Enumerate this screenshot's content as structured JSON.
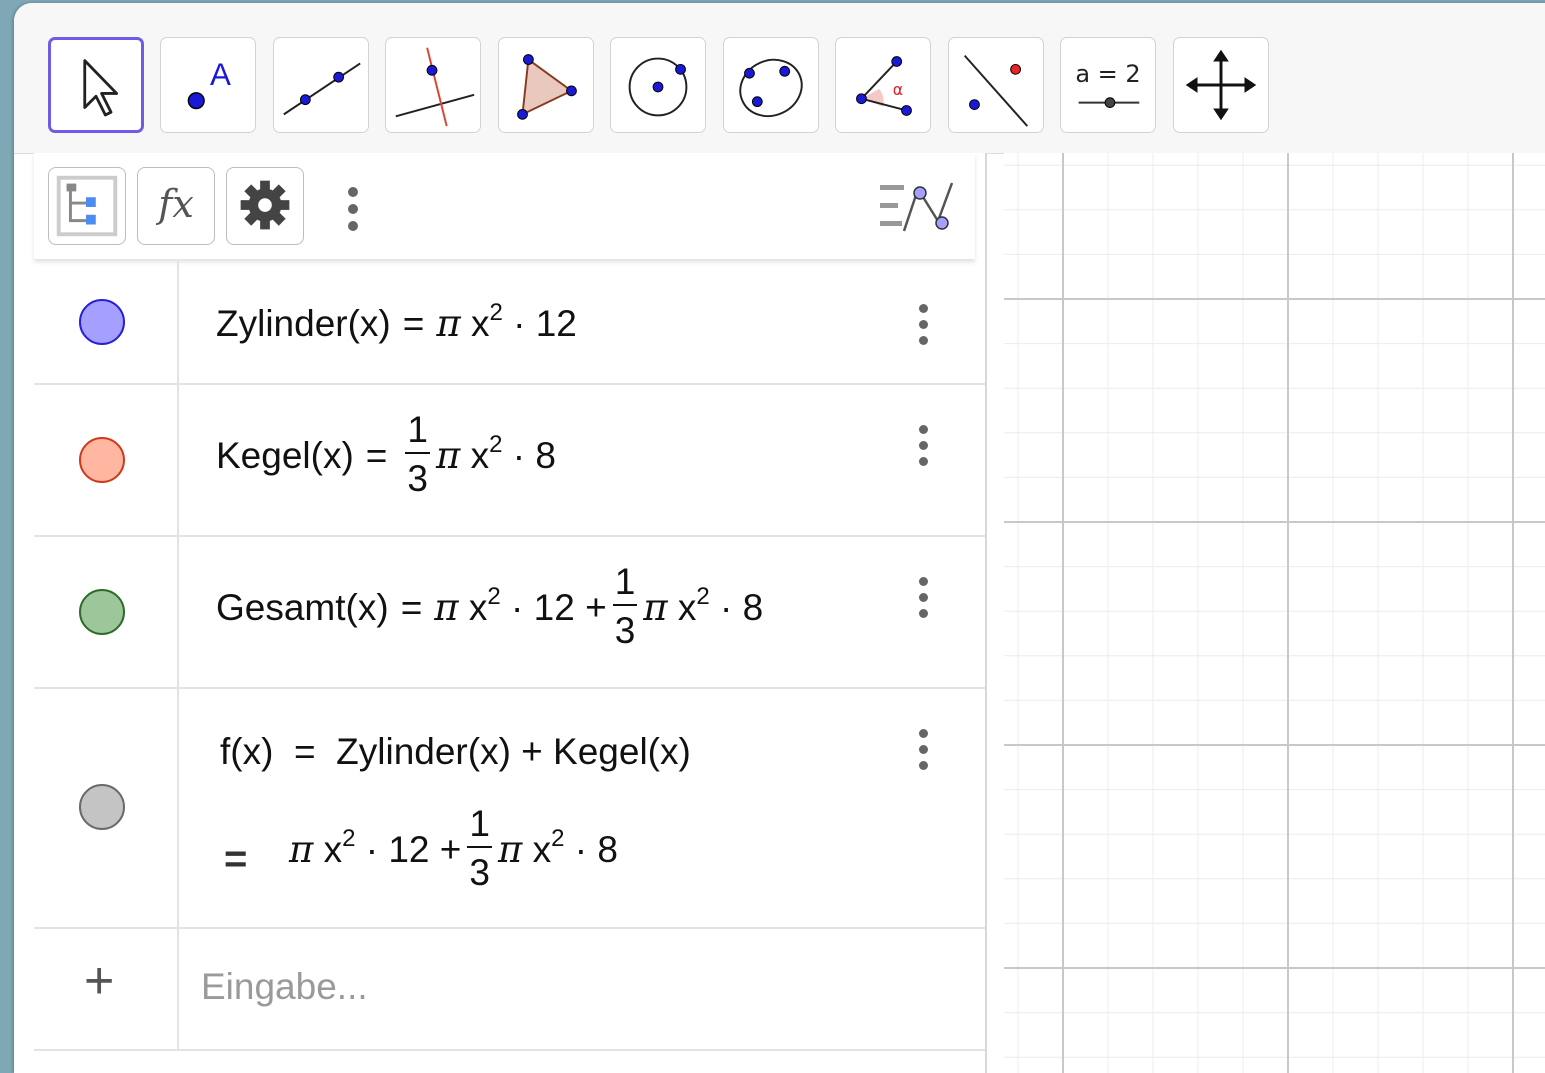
{
  "toolbar": {
    "tools": [
      {
        "name": "move-tool",
        "selected": true
      },
      {
        "name": "point-tool",
        "glyph": "A"
      },
      {
        "name": "line-tool"
      },
      {
        "name": "perpendicular-line-tool"
      },
      {
        "name": "polygon-tool"
      },
      {
        "name": "circle-center-point-tool"
      },
      {
        "name": "conic-five-points-tool"
      },
      {
        "name": "angle-tool",
        "glyph": "α"
      },
      {
        "name": "reflect-tool"
      },
      {
        "name": "slider-tool",
        "label": "a = 2"
      },
      {
        "name": "move-graphics-view-tool"
      }
    ]
  },
  "algebra": {
    "header": {
      "fx_label": "fx",
      "buttons": [
        "algebra-view-toggle",
        "input-bar-toggle",
        "settings",
        "more-menu",
        "keyboard-style-toggle"
      ]
    },
    "rows": [
      {
        "color": "#a5a0ff",
        "border": "#2a1fd6",
        "name": "Zylinder(x)",
        "eq": "=",
        "pi": "π",
        "var": "x",
        "exp": "2",
        "rest": "· 12"
      },
      {
        "color": "#ffb7a2",
        "border": "#d13a1c",
        "name": "Kegel(x)",
        "eq": "=",
        "num": "1",
        "den": "3",
        "pi": "π",
        "var": "x",
        "exp": "2",
        "rest": "· 8"
      },
      {
        "color": "#9dc69a",
        "border": "#2c6d27",
        "name": "Gesamt(x)",
        "eq": "=",
        "pi": "π",
        "var": "x",
        "exp": "2",
        "rest1": "· 12 +",
        "num": "1",
        "den": "3",
        "pi2": "π",
        "var2": "x",
        "exp2": "2",
        "rest2": "· 8"
      },
      {
        "color": "#c4c4c4",
        "border": "#6a6a6a",
        "definition": "f(x)  =  Zylinder(x) + Kegel(x)",
        "result_eq": "=",
        "pi": "π",
        "var": "x",
        "exp": "2",
        "rest1": "· 12 +",
        "num": "1",
        "den": "3",
        "pi2": "π",
        "var2": "x",
        "exp2": "2",
        "rest2": "· 8"
      }
    ],
    "input": {
      "plus": "+",
      "placeholder": "Eingabe..."
    }
  },
  "graphics": {
    "grid": "on",
    "major_grid_color": "#c8c8c8",
    "minor_grid_color": "#ececec"
  }
}
